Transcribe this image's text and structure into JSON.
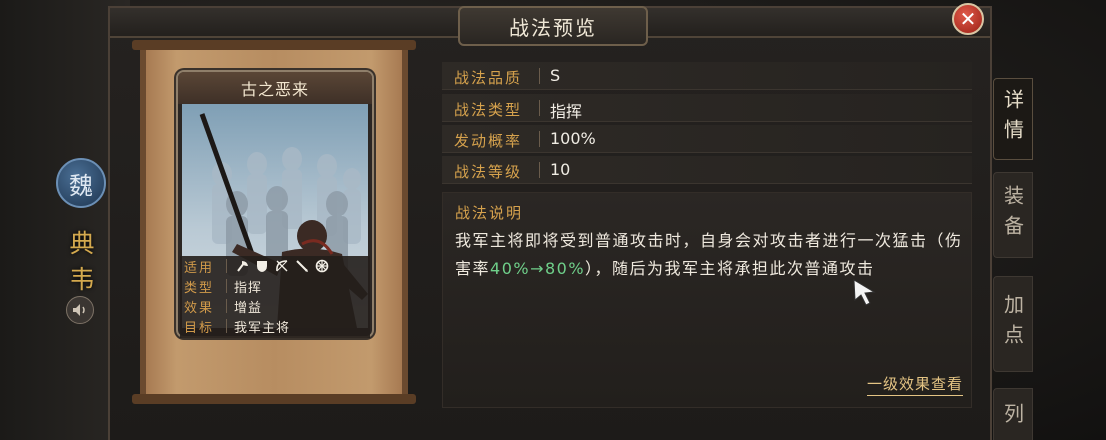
{
  "dialog": {
    "title": "战法预览"
  },
  "sidebar": {
    "faction": "魏",
    "hero_name": "典韦",
    "voice_icon": "speaker-icon"
  },
  "tabs": [
    {
      "label": "详情",
      "active": true
    },
    {
      "label": "装备",
      "active": false
    },
    {
      "label": "加点",
      "active": false
    },
    {
      "label": "列",
      "active": false
    }
  ],
  "card": {
    "name": "古之恶来",
    "rows": [
      {
        "key": "适用",
        "value": "",
        "icons": [
          "axe-icon",
          "shield-icon",
          "bow-icon",
          "spear-icon",
          "wheel-icon"
        ]
      },
      {
        "key": "类型",
        "value": "指挥"
      },
      {
        "key": "效果",
        "value": "增益"
      },
      {
        "key": "目标",
        "value": "我军主将"
      }
    ]
  },
  "stats": [
    {
      "label": "战法品质",
      "value": "S"
    },
    {
      "label": "战法类型",
      "value": "指挥"
    },
    {
      "label": "发动概率",
      "value": "100%"
    },
    {
      "label": "战法等级",
      "value": "10"
    }
  ],
  "description": {
    "title": "战法说明",
    "part1": "我军主将即将受到普通攻击时，自身会对攻击者进行一次猛击（伤害率",
    "highlight": "40%→80%",
    "part2": "），随后为我军主将承担此次普通攻击"
  },
  "level_link": "一级效果查看",
  "colors": {
    "accent": "#d6a24d",
    "highlight": "#6fcf8a",
    "close": "#c0392b"
  }
}
